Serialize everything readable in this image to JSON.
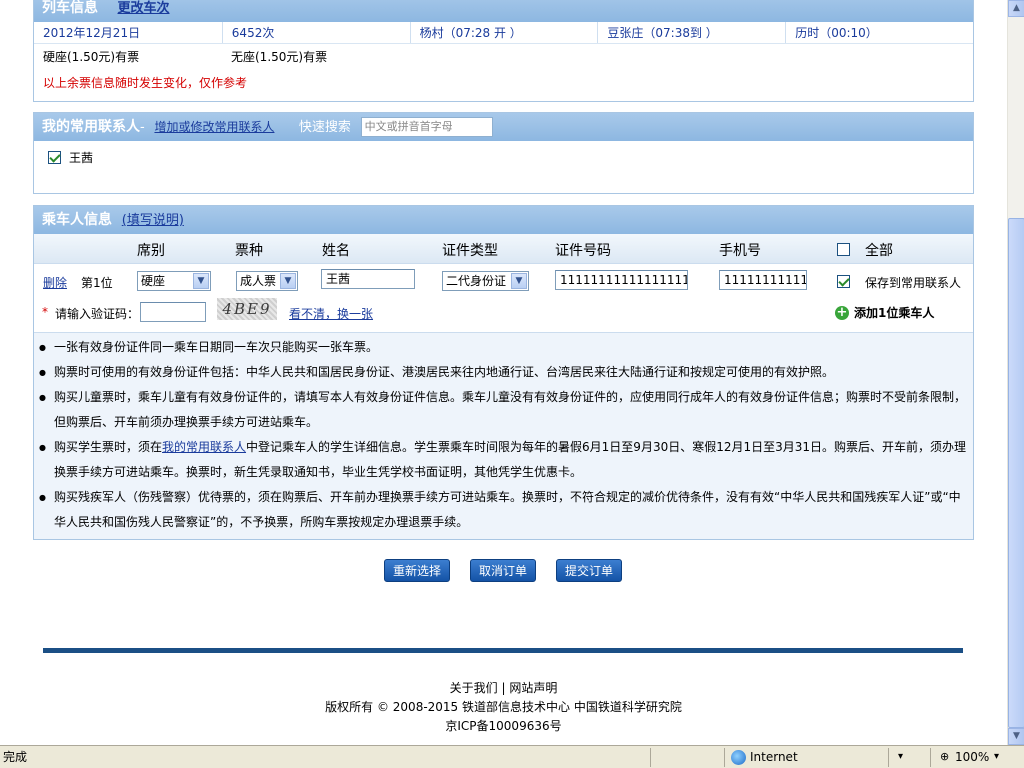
{
  "train_info": {
    "title": "列车信息",
    "change_link": "更改车次",
    "date": "2012年12月21日",
    "train_no": "6452次",
    "from": "杨村（07:28 开 ）",
    "to": "豆张庄（07:38到 ）",
    "duration": "历时（00:10）",
    "ticket_hard_seat": "硬座(1.50元)有票",
    "ticket_no_seat": "无座(1.50元)有票",
    "warning": "以上余票信息随时发生变化，仅作参考"
  },
  "contacts": {
    "title": "我的常用联系人",
    "dash": "-",
    "manage_link": "增加或修改常用联系人",
    "quick_search_label": "快速搜索",
    "quick_search_placeholder": "中文或拼音首字母",
    "items": [
      {
        "name": "王茜",
        "checked": true
      }
    ]
  },
  "passenger": {
    "title": "乘车人信息",
    "help_link": "(填写说明)",
    "headers": {
      "seat": "席别",
      "ticket": "票种",
      "name": "姓名",
      "id_type": "证件类型",
      "id_no": "证件号码",
      "phone": "手机号",
      "all": "全部"
    },
    "row": {
      "delete": "删除",
      "position": "第1位",
      "seat": "硬座",
      "ticket": "成人票",
      "name": "王茜",
      "id_type": "二代身份证",
      "id_no": "111111111111111111",
      "phone": "11111111111",
      "save_label": "保存到常用联系人"
    },
    "captcha": {
      "asterisk": "*",
      "label": "请输入验证码：",
      "image_text": "4BE9",
      "refresh": "看不清，换一张"
    },
    "add_passenger": "添加1位乘车人",
    "notes": [
      "一张有效身份证件同一乘车日期同一车次只能购买一张车票。",
      "购票时可使用的有效身份证件包括：中华人民共和国居民身份证、港澳居民来往内地通行证、台湾居民来往大陆通行证和按规定可使用的有效护照。",
      "购买儿童票时，乘车儿童有有效身份证件的，请填写本人有效身份证件信息。乘车儿童没有有效身份证件的，应使用同行成年人的有效身份证件信息；购票时不受前条限制，但购票后、开车前须办理换票手续方可进站乘车。",
      "购买残疾军人（伤残警察）优待票的，须在购票后、开车前办理换票手续方可进站乘车。换票时，不符合规定的减价优待条件，没有有效“中华人民共和国残疾军人证”或“中华人民共和国伤残人民警察证”的，不予换票，所购车票按规定办理退票手续。"
    ],
    "student_note": {
      "pre": "购买学生票时，须在",
      "link": "我的常用联系人",
      "post": "中登记乘车人的学生详细信息。学生票乘车时间限为每年的暑假6月1日至9月30日、寒假12月1日至3月31日。购票后、开车前，须办理换票手续方可进站乘车。换票时，新生凭录取通知书，毕业生凭学校书面证明，其他凭学生优惠卡。"
    }
  },
  "buttons": {
    "reset": "重新选择",
    "cancel": "取消订单",
    "submit": "提交订单"
  },
  "footer": {
    "about": "关于我们",
    "divider": "|",
    "statement": "网站声明",
    "copyright": "版权所有 © 2008-2015 铁道部信息技术中心 中国铁道科学研究院",
    "icp": "京ICP备10009636号"
  },
  "statusbar": {
    "status": "完成",
    "zone": "Internet",
    "zoom": "100%"
  },
  "icons": {
    "add": "plus-circle-icon",
    "checkbox": "checkbox-icon",
    "globe": "globe-icon"
  }
}
